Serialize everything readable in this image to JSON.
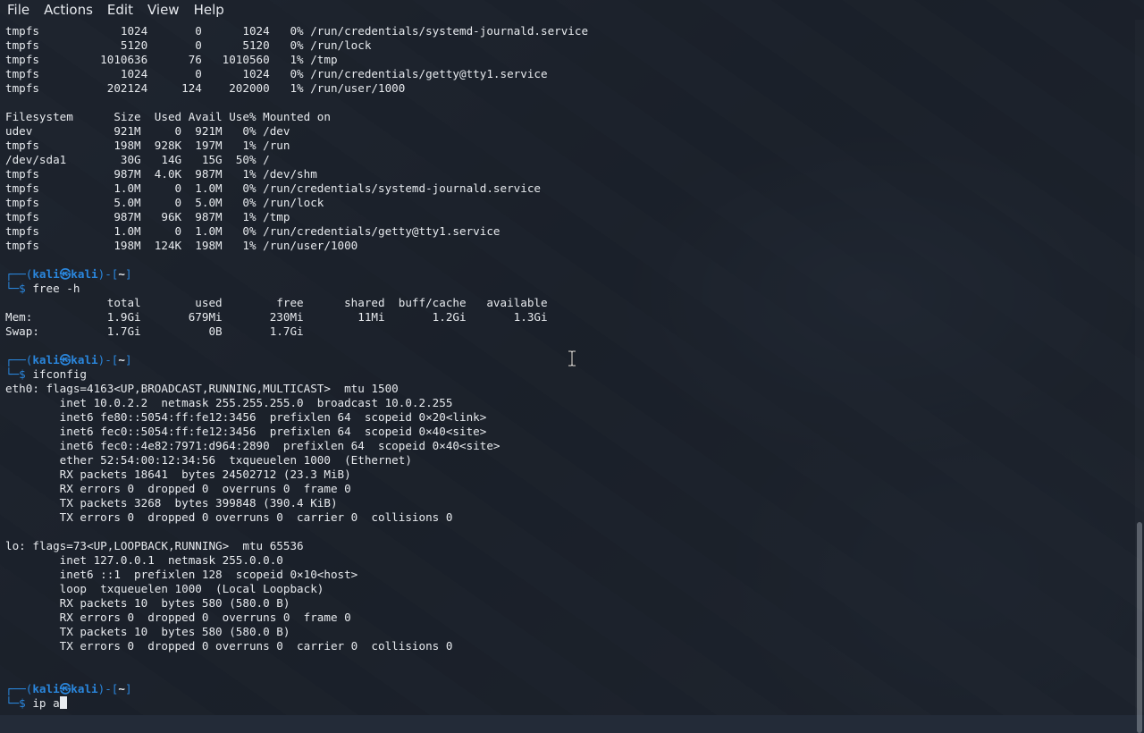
{
  "window": {
    "menu": [
      "File",
      "Actions",
      "Edit",
      "View",
      "Help"
    ]
  },
  "prompt": {
    "user": "kali",
    "host": "kali",
    "dir": "~"
  },
  "sections": [
    {
      "lines": [
        "tmpfs            1024       0      1024   0% /run/credentials/systemd-journald.service",
        "tmpfs            5120       0      5120   0% /run/lock",
        "tmpfs         1010636      76   1010560   1% /tmp",
        "tmpfs            1024       0      1024   0% /run/credentials/getty@tty1.service",
        "tmpfs          202124     124    202000   1% /run/user/1000",
        "",
        "Filesystem      Size  Used Avail Use% Mounted on",
        "udev            921M     0  921M   0% /dev",
        "tmpfs           198M  928K  197M   1% /run",
        "/dev/sda1        30G   14G   15G  50% /",
        "tmpfs           987M  4.0K  987M   1% /dev/shm",
        "tmpfs           1.0M     0  1.0M   0% /run/credentials/systemd-journald.service",
        "tmpfs           5.0M     0  5.0M   0% /run/lock",
        "tmpfs           987M   96K  987M   1% /tmp",
        "tmpfs           1.0M     0  1.0M   0% /run/credentials/getty@tty1.service",
        "tmpfs           198M  124K  198M   1% /run/user/1000",
        ""
      ]
    },
    {
      "command": "free -h",
      "lines": [
        "               total        used        free      shared  buff/cache   available",
        "Mem:           1.9Gi       679Mi       230Mi        11Mi       1.2Gi       1.3Gi",
        "Swap:          1.7Gi          0B       1.7Gi",
        ""
      ]
    },
    {
      "command": "ifconfig",
      "lines": [
        "eth0: flags=4163<UP,BROADCAST,RUNNING,MULTICAST>  mtu 1500",
        "        inet 10.0.2.2  netmask 255.255.255.0  broadcast 10.0.2.255",
        "        inet6 fe80::5054:ff:fe12:3456  prefixlen 64  scopeid 0×20<link>",
        "        inet6 fec0::5054:ff:fe12:3456  prefixlen 64  scopeid 0×40<site>",
        "        inet6 fec0::4e82:7971:d964:2890  prefixlen 64  scopeid 0×40<site>",
        "        ether 52:54:00:12:34:56  txqueuelen 1000  (Ethernet)",
        "        RX packets 18641  bytes 24502712 (23.3 MiB)",
        "        RX errors 0  dropped 0  overruns 0  frame 0",
        "        TX packets 3268  bytes 399848 (390.4 KiB)",
        "        TX errors 0  dropped 0 overruns 0  carrier 0  collisions 0",
        "",
        "lo: flags=73<UP,LOOPBACK,RUNNING>  mtu 65536",
        "        inet 127.0.0.1  netmask 255.0.0.0",
        "        inet6 ::1  prefixlen 128  scopeid 0×10<host>",
        "        loop  txqueuelen 1000  (Local Loopback)",
        "        RX packets 10  bytes 580 (580.0 B)",
        "        RX errors 0  dropped 0  overruns 0  frame 0",
        "        TX packets 10  bytes 580 (580.0 B)",
        "        TX errors 0  dropped 0 overruns 0  carrier 0  collisions 0",
        "",
        ""
      ]
    }
  ],
  "current_input": "ip a",
  "colors": {
    "prompt_frame": "#2a86dc",
    "text": "#e7eaee",
    "background": "#1a1f28"
  }
}
